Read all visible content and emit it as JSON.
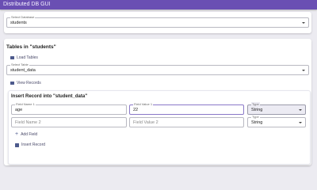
{
  "app": {
    "title": "Distributed DB GUI"
  },
  "database_select": {
    "label": "Select Database",
    "value": "students"
  },
  "tables_section": {
    "heading": "Tables in \"students\"",
    "load_tables_label": "Load Tables",
    "table_select": {
      "label": "Select Table",
      "value": "student_data"
    },
    "view_records_label": "View Records"
  },
  "insert_section": {
    "heading": "Insert Record into \"student_data\"",
    "rows": [
      {
        "field_name_label": "Field Name 1",
        "field_name_value": "age",
        "field_value_label": "Field Value 1",
        "field_value_value": "22",
        "type_label": "Type",
        "type_value": "String"
      },
      {
        "field_name_placeholder": "Field Name 2",
        "field_value_placeholder": "Field Value 2",
        "type_label": "Type",
        "type_value": "String"
      }
    ],
    "add_field_label": "Add Field",
    "insert_record_label": "Insert Record"
  },
  "colors": {
    "appbar": "#6a4fb3",
    "accent": "#4d5a8c",
    "background": "#ecebf1"
  }
}
